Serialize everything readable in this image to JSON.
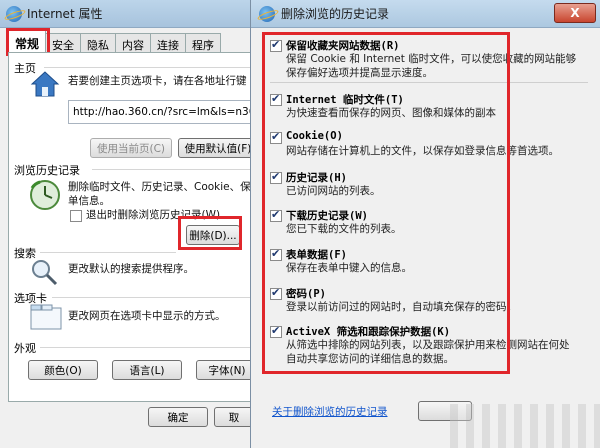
{
  "options_window": {
    "title": "Internet 属性",
    "tabs": [
      "常规",
      "安全",
      "隐私",
      "内容",
      "连接",
      "程序"
    ],
    "home": {
      "label": "主页",
      "desc": "若要创建主页选项卡，请在各地址行键",
      "url": "http://hao.360.cn/?src=lm&ls=n36a",
      "btn_current": "使用当前页(C)",
      "btn_default": "使用默认值(F)"
    },
    "history": {
      "label": "浏览历史记录",
      "desc_line1": "删除临时文件、历史记录、Cookie、保",
      "desc_line2": "单信息。",
      "exit_delete": "退出时删除浏览历史记录(W)",
      "btn_delete": "删除(D)..."
    },
    "search": {
      "label": "搜索",
      "desc": "更改默认的搜索提供程序。"
    },
    "tabs_section": {
      "label": "选项卡",
      "desc": "更改网页在选项卡中显示的方式。"
    },
    "appearance": {
      "label": "外观",
      "btn_color": "颜色(O)",
      "btn_lang": "语言(L)",
      "btn_font": "字体(N)"
    },
    "btn_ok": "确定",
    "btn_cancel": "取"
  },
  "delete_dialog": {
    "title": "删除浏览的历史记录",
    "close_glyph": "X",
    "options": [
      {
        "title": "保留收藏夹网站数据(R)",
        "desc": "保留 Cookie 和 Internet 临时文件，可以使您收藏的网站能够保存偏好选项并提高显示速度。"
      },
      {
        "title": "Internet 临时文件(T)",
        "desc": "为快速查看而保存的网页、图像和媒体的副本"
      },
      {
        "title": "Cookie(O)",
        "desc": "网站存储在计算机上的文件，以保存如登录信息等首选项。"
      },
      {
        "title": "历史记录(H)",
        "desc": "已访问网站的列表。"
      },
      {
        "title": "下载历史记录(W)",
        "desc": "您已下载的文件的列表。"
      },
      {
        "title": "表单数据(F)",
        "desc": "保存在表单中键入的信息。"
      },
      {
        "title": "密码(P)",
        "desc": "登录以前访问过的网站时，自动填充保存的密码。"
      },
      {
        "title": "ActiveX 筛选和跟踪保护数据(K)",
        "desc": "从筛选中排除的网站列表，以及跟踪保护用来检测网站在何处自动共享您访问的详细信息的数据。"
      }
    ],
    "link": "关于删除浏览的历史记录"
  },
  "colors": {
    "highlight": "#e0262b",
    "link": "#1155cc"
  }
}
